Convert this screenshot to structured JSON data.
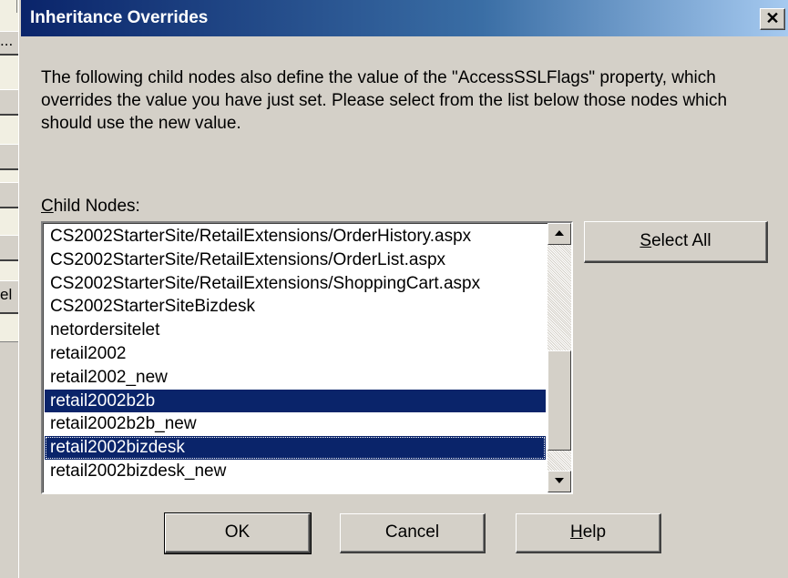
{
  "background_window": {
    "button_fragments": [
      "...",
      "",
      "",
      "",
      "",
      "el"
    ]
  },
  "dialog": {
    "title": "Inheritance Overrides",
    "close_glyph": "✕",
    "message": "The following child nodes also define the value of the  \"AccessSSLFlags\" property, which overrides the value you have just set.  Please select from the list below those nodes which should use the new value.",
    "child_nodes_label_accel": "C",
    "child_nodes_label_rest": "hild Nodes:",
    "child_nodes": [
      {
        "label": "CS2002StarterSite/RetailExtensions/OrderHistory.aspx",
        "selected": false
      },
      {
        "label": "CS2002StarterSite/RetailExtensions/OrderList.aspx",
        "selected": false
      },
      {
        "label": "CS2002StarterSite/RetailExtensions/ShoppingCart.aspx",
        "selected": false
      },
      {
        "label": "CS2002StarterSiteBizdesk",
        "selected": false
      },
      {
        "label": "netordersitelet",
        "selected": false
      },
      {
        "label": "retail2002",
        "selected": false
      },
      {
        "label": "retail2002_new",
        "selected": false
      },
      {
        "label": "retail2002b2b",
        "selected": true
      },
      {
        "label": "retail2002b2b_new",
        "selected": false
      },
      {
        "label": "retail2002bizdesk",
        "selected": true
      },
      {
        "label": "retail2002bizdesk_new",
        "selected": false
      }
    ],
    "select_all_accel": "S",
    "select_all_rest": "elect All",
    "ok_label": "OK",
    "cancel_label": "Cancel",
    "help_accel": "H",
    "help_rest": "elp",
    "colors": {
      "title_bar_start": "#0a246a",
      "selection": "#0a246a",
      "face": "#d4d0c8"
    }
  }
}
